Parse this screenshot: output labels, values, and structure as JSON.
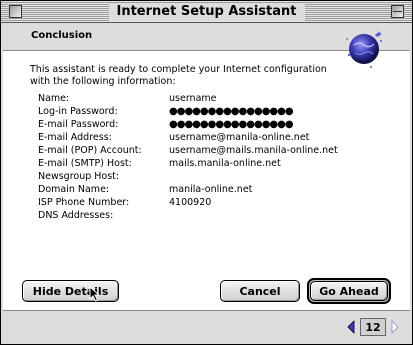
{
  "window": {
    "title": "Internet Setup Assistant"
  },
  "section": {
    "title": "Conclusion"
  },
  "intro": "This assistant is ready to complete your Internet configuration with the following information:",
  "details": [
    {
      "label": "Name:",
      "value": "username"
    },
    {
      "label": "Log-in Password:",
      "value": "●●●●●●●●●●●●●●●●"
    },
    {
      "label": "E-mail Password:",
      "value": "●●●●●●●●●●●●●●●●"
    },
    {
      "label": "E-mail Address:",
      "value": "username@manila-online.net"
    },
    {
      "label": "E-mail (POP) Account:",
      "value": "username@mails.manila-online.net"
    },
    {
      "label": "E-mail (SMTP) Host:",
      "value": "mails.manila-online.net"
    },
    {
      "label": "Newsgroup Host:",
      "value": ""
    },
    {
      "label": "Domain Name:",
      "value": "manila-online.net"
    },
    {
      "label": "ISP Phone Number:",
      "value": "4100920"
    },
    {
      "label": "DNS Addresses:",
      "value": ""
    }
  ],
  "buttons": {
    "hide_details": "Hide Details",
    "cancel": "Cancel",
    "go_ahead": "Go Ahead"
  },
  "pager": {
    "page": "12"
  },
  "icons": {
    "close": "close-box-icon",
    "collapse": "collapse-box-icon",
    "logo": "globe-icon",
    "prev": "left-arrow-icon",
    "next": "right-arrow-icon",
    "cursor": "mouse-pointer-icon"
  },
  "colors": {
    "pager_arrow": "#3a3ac8",
    "globe": "#4a4ab8"
  }
}
